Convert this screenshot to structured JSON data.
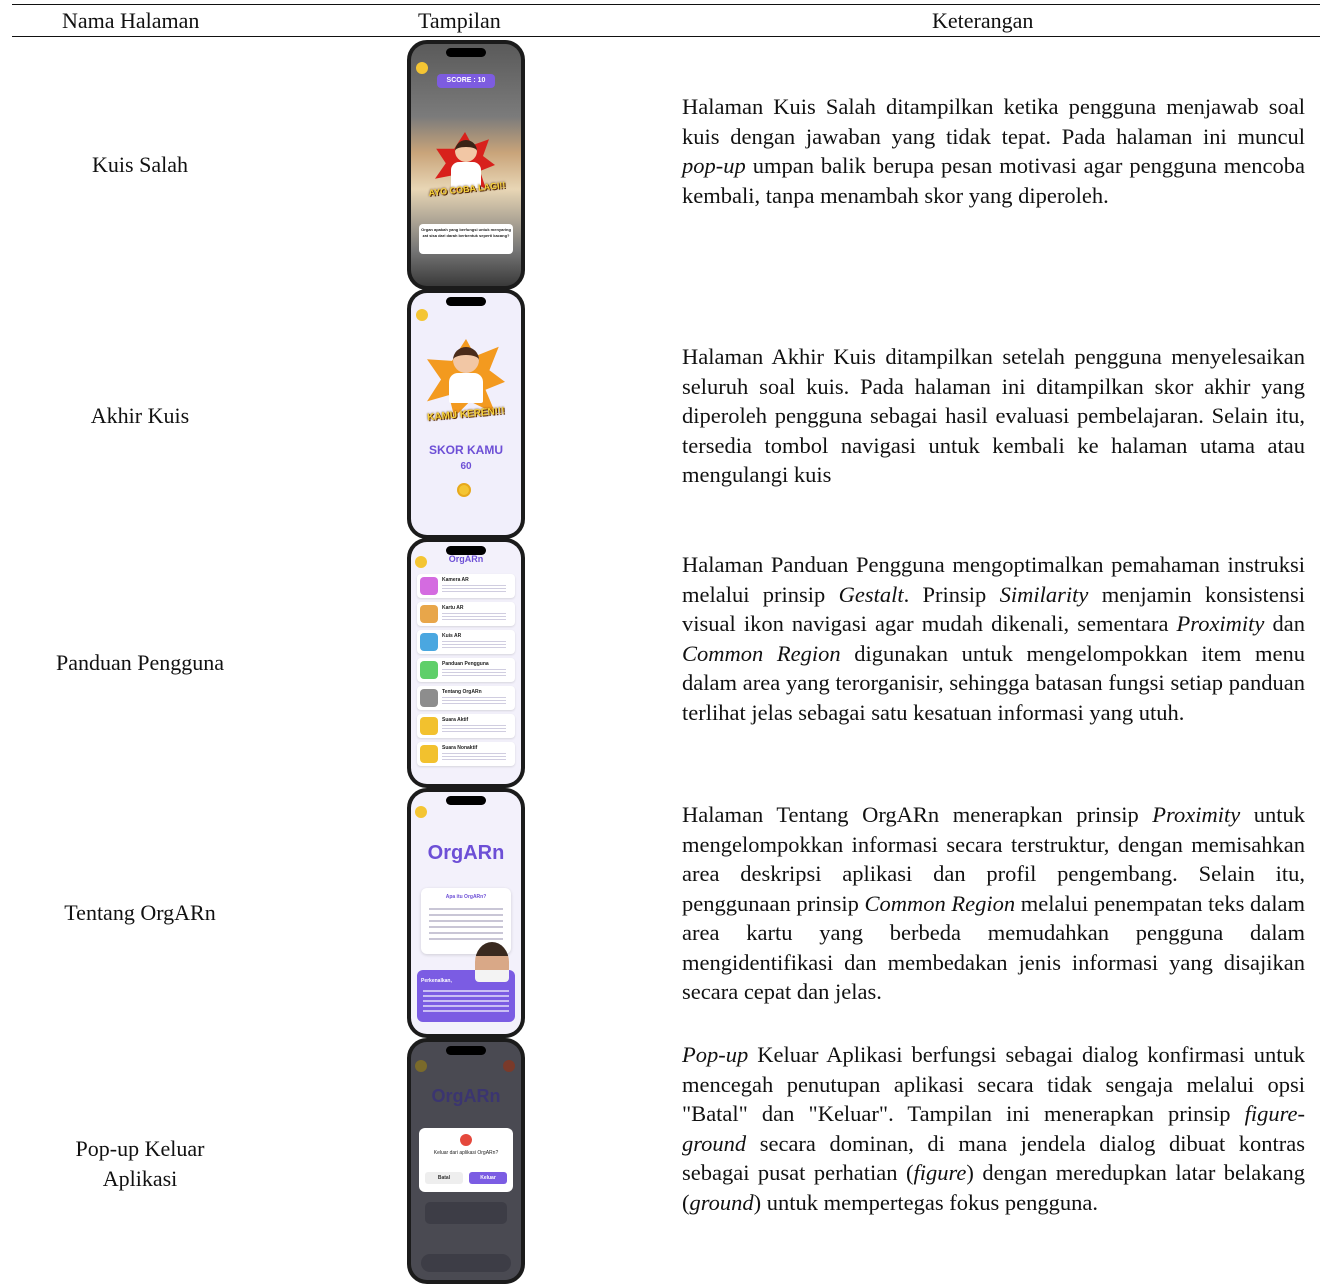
{
  "header": {
    "col1": "Nama Halaman",
    "col2": "Tampilan",
    "col3": "Keterangan"
  },
  "rows": [
    {
      "name": "Kuis Salah",
      "desc": [
        {
          "t": "Halaman Kuis Salah ditampilkan ketika pengguna menjawab soal kuis dengan jawaban yang tidak tepat. Pada halaman ini muncul "
        },
        {
          "t": "pop-up",
          "i": true
        },
        {
          "t": " umpan balik berupa pesan motivasi agar pengguna mencoba kembali, tanpa menambah skor yang diperoleh."
        }
      ],
      "screen": {
        "score_label": "SCORE : 10",
        "banner": "AYO COBA LAGI!!",
        "question": "Organ apakah yang berfungsi untuk menyaring zat sisa dari darah berbentuk seperti kacang?"
      }
    },
    {
      "name": "Akhir Kuis",
      "desc": [
        {
          "t": "Halaman Akhir Kuis ditampilkan setelah pengguna menyelesaikan seluruh soal kuis. Pada halaman ini ditampilkan skor akhir yang diperoleh pengguna sebagai hasil evaluasi pembelajaran. Selain itu, tersedia tombol navigasi untuk kembali ke halaman utama atau mengulangi kuis"
        }
      ],
      "screen": {
        "banner": "KAMU KEREN!!!",
        "score_title": "SKOR KAMU",
        "score_value": "60"
      }
    },
    {
      "name": "Panduan Pengguna",
      "desc": [
        {
          "t": "Halaman Panduan Pengguna mengoptimalkan pemahaman instruksi melalui prinsip "
        },
        {
          "t": "Gestalt",
          "i": true
        },
        {
          "t": ". Prinsip "
        },
        {
          "t": "Similarity",
          "i": true
        },
        {
          "t": " menjamin konsistensi visual ikon navigasi agar mudah dikenali, sementara "
        },
        {
          "t": "Proximity",
          "i": true
        },
        {
          "t": " dan "
        },
        {
          "t": "Common Region",
          "i": true
        },
        {
          "t": " digunakan untuk mengelompokkan item menu dalam area yang terorganisir, sehingga batasan fungsi setiap panduan terlihat jelas sebagai satu kesatuan informasi yang utuh."
        }
      ],
      "screen": {
        "logo": "OrgARn",
        "items": [
          {
            "label": "Kamera AR",
            "color": "#d46be0"
          },
          {
            "label": "Kartu AR",
            "color": "#e8a64a"
          },
          {
            "label": "Kuis AR",
            "color": "#4aa7e0"
          },
          {
            "label": "Panduan Pengguna",
            "color": "#5fcf6a"
          },
          {
            "label": "Tentang OrgARn",
            "color": "#8d8d8d"
          },
          {
            "label": "Suara Aktif",
            "color": "#f2c12e"
          },
          {
            "label": "Suara Nonaktif",
            "color": "#f2c12e"
          }
        ]
      }
    },
    {
      "name": "Tentang OrgARn",
      "desc": [
        {
          "t": "Halaman Tentang OrgARn menerapkan prinsip "
        },
        {
          "t": "Proximity",
          "i": true
        },
        {
          "t": " untuk mengelompokkan informasi secara terstruktur, dengan memisahkan area deskripsi aplikasi dan profil pengembang. Selain itu, penggunaan prinsip "
        },
        {
          "t": "Common Region",
          "i": true
        },
        {
          "t": " melalui penempatan teks dalam area kartu yang berbeda memudahkan pengguna dalam mengidentifikasi dan membedakan jenis informasi yang disajikan secara cepat dan jelas."
        }
      ],
      "screen": {
        "logo": "OrgARn",
        "card_title": "Apa itu OrgARn?",
        "profile_title": "Perkenalkan,"
      }
    },
    {
      "name": "Pop-up Keluar Aplikasi",
      "desc": [
        {
          "t": "Pop-up",
          "i": true
        },
        {
          "t": " Keluar Aplikasi berfungsi sebagai dialog konfirmasi untuk mencegah penutupan aplikasi secara tidak sengaja melalui opsi \"Batal\" dan \"Keluar\". Tampilan ini menerapkan prinsip "
        },
        {
          "t": "figure-ground",
          "i": true
        },
        {
          "t": " secara dominan, di mana jendela dialog dibuat kontras sebagai pusat perhatian ("
        },
        {
          "t": "figure",
          "i": true
        },
        {
          "t": ") dengan meredupkan latar belakang ("
        },
        {
          "t": "ground",
          "i": true
        },
        {
          "t": ") untuk mempertegas fokus pengguna."
        }
      ],
      "screen": {
        "logo": "OrgARn",
        "dialog_title": "Keluar dari aplikasi OrgARn?",
        "cancel": "Batal",
        "exit": "Keluar"
      }
    }
  ]
}
